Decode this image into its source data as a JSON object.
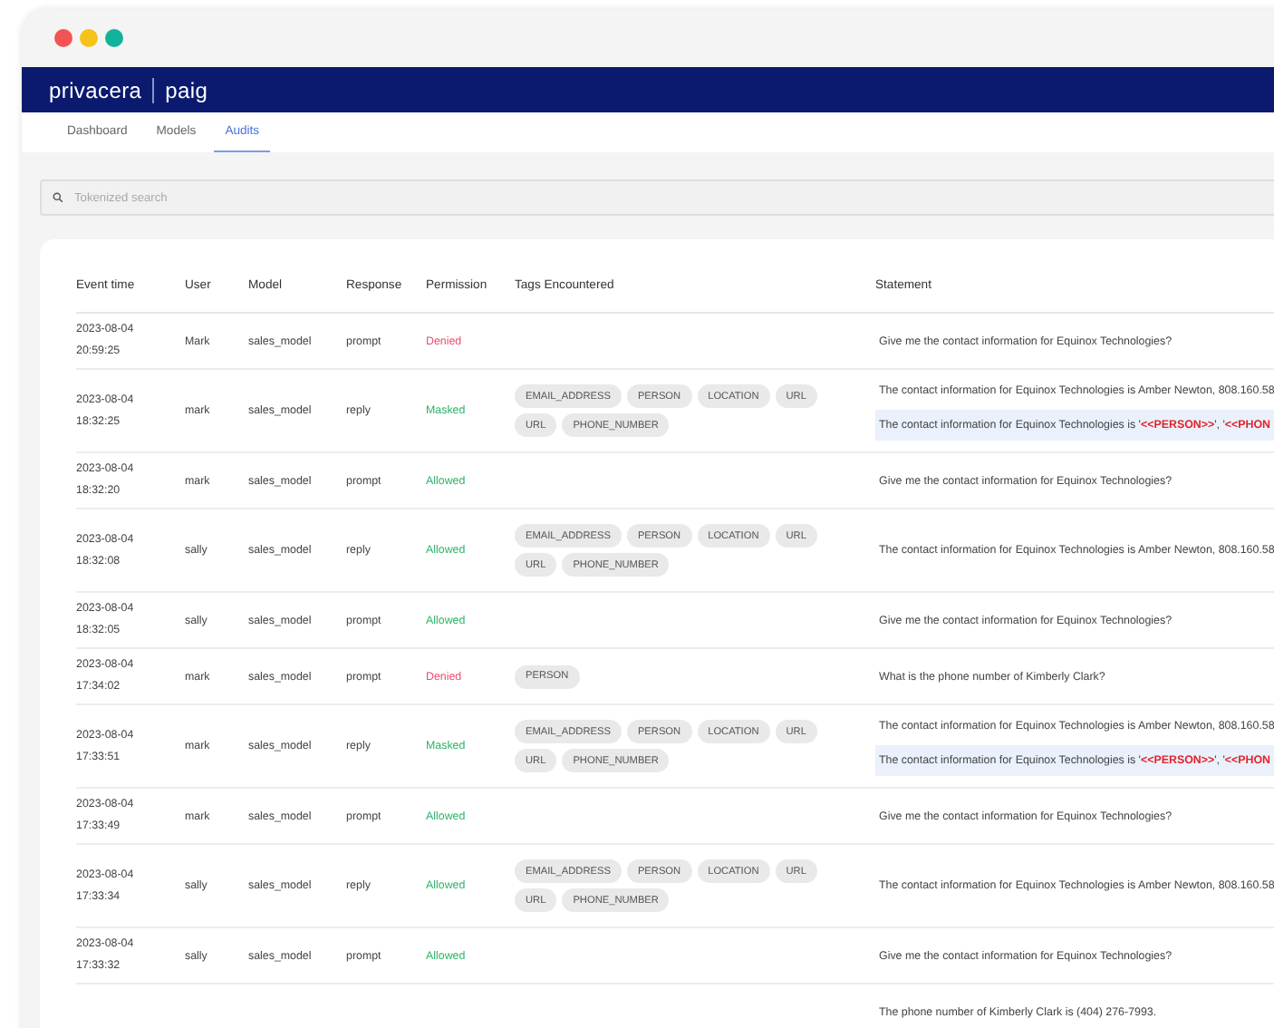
{
  "window": {
    "dots": [
      {
        "color": "#f25454"
      },
      {
        "color": "#f5c21a"
      },
      {
        "color": "#12b39b"
      }
    ]
  },
  "brand": {
    "company": "privacera",
    "product": "paig"
  },
  "tabs": [
    {
      "label": "Dashboard",
      "selected": false
    },
    {
      "label": "Models",
      "selected": false
    },
    {
      "label": "Audits",
      "selected": true
    }
  ],
  "search": {
    "placeholder": "Tokenized search"
  },
  "table": {
    "columns": [
      "Event time",
      "User",
      "Model",
      "Response",
      "Permission",
      "Tags Encountered",
      "Statement"
    ],
    "rows": [
      {
        "date": "2023-08-04",
        "time": "20:59:25",
        "user": "Mark",
        "model": "sales_model",
        "response": "prompt",
        "permission": {
          "text": "Denied",
          "color": "#ee4d6f"
        },
        "tags": [],
        "statements": [
          {
            "kind": "plain",
            "text": "Give me the contact information for Equinox Technologies?"
          }
        ]
      },
      {
        "date": "2023-08-04",
        "time": "18:32:25",
        "user": "mark",
        "model": "sales_model",
        "response": "reply",
        "permission": {
          "text": "Masked",
          "color": "#2fb36b"
        },
        "tags": [
          "EMAIL_ADDRESS",
          "PERSON",
          "LOCATION",
          "URL",
          "URL",
          "PHONE_NUMBER"
        ],
        "statements": [
          {
            "kind": "plain",
            "text": "The contact information for Equinox Technologies is Amber Newton, 808.160.58"
          },
          {
            "kind": "masked",
            "parts": [
              {
                "text": "The contact information for Equinox Technologies is '",
                "redacted": false
              },
              {
                "text": "<<PERSON>>",
                "redacted": true
              },
              {
                "text": "', '",
                "redacted": false
              },
              {
                "text": "<<PHON",
                "redacted": true
              }
            ]
          }
        ]
      },
      {
        "date": "2023-08-04",
        "time": "18:32:20",
        "user": "mark",
        "model": "sales_model",
        "response": "prompt",
        "permission": {
          "text": "Allowed",
          "color": "#2fb36b"
        },
        "tags": [],
        "statements": [
          {
            "kind": "plain",
            "text": "Give me the contact information for Equinox Technologies?"
          }
        ]
      },
      {
        "date": "2023-08-04",
        "time": "18:32:08",
        "user": "sally",
        "model": "sales_model",
        "response": "reply",
        "permission": {
          "text": "Allowed",
          "color": "#2fb36b"
        },
        "tags": [
          "EMAIL_ADDRESS",
          "PERSON",
          "LOCATION",
          "URL",
          "URL",
          "PHONE_NUMBER"
        ],
        "statements": [
          {
            "kind": "plain",
            "text": "The contact information for Equinox Technologies is Amber Newton, 808.160.58"
          }
        ]
      },
      {
        "date": "2023-08-04",
        "time": "18:32:05",
        "user": "sally",
        "model": "sales_model",
        "response": "prompt",
        "permission": {
          "text": "Allowed",
          "color": "#2fb36b"
        },
        "tags": [],
        "statements": [
          {
            "kind": "plain",
            "text": "Give me the contact information for Equinox Technologies?"
          }
        ]
      },
      {
        "date": "2023-08-04",
        "time": "17:34:02",
        "user": "mark",
        "model": "sales_model",
        "response": "prompt",
        "permission": {
          "text": "Denied",
          "color": "#ee4d6f"
        },
        "tags": [
          "PERSON"
        ],
        "statements": [
          {
            "kind": "plain",
            "text": "What is the phone number of Kimberly Clark?"
          }
        ]
      },
      {
        "date": "2023-08-04",
        "time": "17:33:51",
        "user": "mark",
        "model": "sales_model",
        "response": "reply",
        "permission": {
          "text": "Masked",
          "color": "#2fb36b"
        },
        "tags": [
          "EMAIL_ADDRESS",
          "PERSON",
          "LOCATION",
          "URL",
          "URL",
          "PHONE_NUMBER"
        ],
        "statements": [
          {
            "kind": "plain",
            "text": "The contact information for Equinox Technologies is Amber Newton, 808.160.58"
          },
          {
            "kind": "masked",
            "parts": [
              {
                "text": "The contact information for Equinox Technologies is '",
                "redacted": false
              },
              {
                "text": "<<PERSON>>",
                "redacted": true
              },
              {
                "text": "', '",
                "redacted": false
              },
              {
                "text": "<<PHON",
                "redacted": true
              }
            ]
          }
        ]
      },
      {
        "date": "2023-08-04",
        "time": "17:33:49",
        "user": "mark",
        "model": "sales_model",
        "response": "prompt",
        "permission": {
          "text": "Allowed",
          "color": "#2fb36b"
        },
        "tags": [],
        "statements": [
          {
            "kind": "plain",
            "text": "Give me the contact information for Equinox Technologies?"
          }
        ]
      },
      {
        "date": "2023-08-04",
        "time": "17:33:34",
        "user": "sally",
        "model": "sales_model",
        "response": "reply",
        "permission": {
          "text": "Allowed",
          "color": "#2fb36b"
        },
        "tags": [
          "EMAIL_ADDRESS",
          "PERSON",
          "LOCATION",
          "URL",
          "URL",
          "PHONE_NUMBER"
        ],
        "statements": [
          {
            "kind": "plain",
            "text": "The contact information for Equinox Technologies is Amber Newton, 808.160.58"
          }
        ]
      },
      {
        "date": "2023-08-04",
        "time": "17:33:32",
        "user": "sally",
        "model": "sales_model",
        "response": "prompt",
        "permission": {
          "text": "Allowed",
          "color": "#2fb36b"
        },
        "tags": [],
        "statements": [
          {
            "kind": "plain",
            "text": "Give me the contact information for Equinox Technologies?"
          }
        ]
      },
      {
        "tags": [],
        "statements": [
          {
            "kind": "plain",
            "text": "The phone number of Kimberly Clark is (404) 276-7993."
          }
        ]
      }
    ]
  }
}
